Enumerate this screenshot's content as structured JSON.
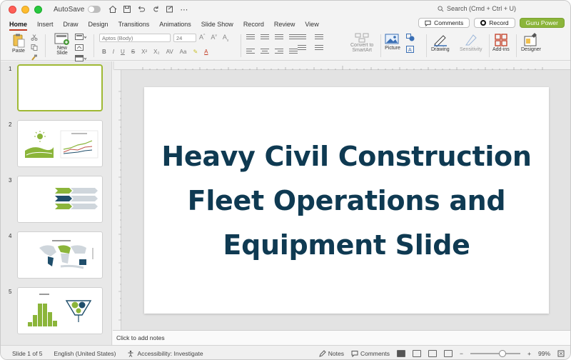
{
  "titlebar": {
    "autosave_label": "AutoSave",
    "search_placeholder": "Search (Cmd + Ctrl + U)"
  },
  "tabs": [
    "Home",
    "Insert",
    "Draw",
    "Design",
    "Transitions",
    "Animations",
    "Slide Show",
    "Record",
    "Review",
    "View"
  ],
  "active_tab": "Home",
  "header_buttons": {
    "comments": "Comments",
    "record": "Record",
    "addin": "Guru Power"
  },
  "ribbon": {
    "paste": "Paste",
    "new_slide_line1": "New",
    "new_slide_line2": "Slide",
    "font_name": "Aptos (Body)",
    "font_size": "24",
    "convert_line1": "Convert to",
    "convert_line2": "SmartArt",
    "picture": "Picture",
    "drawing": "Drawing",
    "sensitivity": "Sensitivity",
    "addins": "Add-ins",
    "designer": "Designer"
  },
  "slides": [
    {
      "number": "1"
    },
    {
      "number": "2"
    },
    {
      "number": "3"
    },
    {
      "number": "4"
    },
    {
      "number": "5"
    }
  ],
  "slide": {
    "title": "Heavy Civil Construction Fleet Operations and Equipment Slide"
  },
  "notes_placeholder": "Click to add notes",
  "status": {
    "slide_of": "Slide 1 of 5",
    "language": "English (United States)",
    "accessibility": "Accessibility: Investigate",
    "notes": "Notes",
    "comments": "Comments",
    "zoom": "99%"
  },
  "colors": {
    "accent_green": "#8bb53a",
    "title_navy": "#0f3a52",
    "tab_underline": "#c23b22"
  }
}
